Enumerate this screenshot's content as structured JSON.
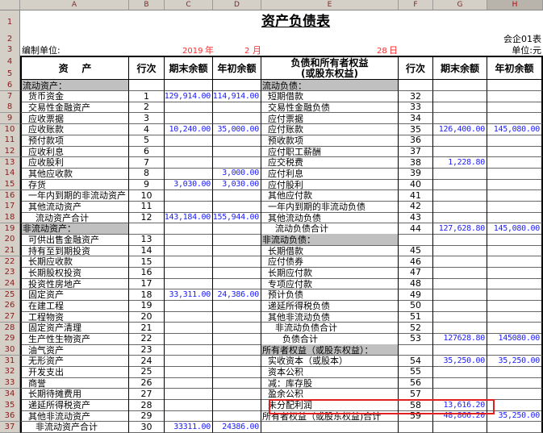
{
  "columns": [
    "A",
    "B",
    "C",
    "D",
    "E",
    "F",
    "G",
    "H"
  ],
  "selected_column": "H",
  "title": "资产负债表",
  "form_code": "会企01表",
  "compiler_label": "编制单位:",
  "date": {
    "year": "2019",
    "year_unit": "年",
    "month": "2",
    "month_unit": "月",
    "day": "28",
    "day_unit": "日"
  },
  "unit": "单位:元",
  "headers": {
    "assets": "资    产",
    "line": "行次",
    "end_balance": "期末余额",
    "begin_balance": "年初余额",
    "liabilities": "负债和所有者权益",
    "liabilities_sub": "(或股东权益)"
  },
  "highlight_color": "#e02020",
  "highlighted_item": "未分配利润",
  "rows": [
    {
      "r": 6,
      "left": {
        "label": "流动资产：",
        "section": true
      },
      "right": {
        "label": "流动负债：",
        "section": true
      }
    },
    {
      "r": 7,
      "left": {
        "label": "货币资金",
        "line": "1",
        "end": "129,914.00",
        "begin": "114,914.00"
      },
      "right": {
        "label": "短期借款",
        "line": "32"
      }
    },
    {
      "r": 8,
      "left": {
        "label": "交易性金融资产",
        "line": "2"
      },
      "right": {
        "label": "交易性金融负债",
        "line": "33"
      }
    },
    {
      "r": 9,
      "left": {
        "label": "应收票据",
        "line": "3"
      },
      "right": {
        "label": "应付票据",
        "line": "34"
      }
    },
    {
      "r": 10,
      "left": {
        "label": "应收账款",
        "line": "4",
        "end": "10,240.00",
        "begin": "35,000.00"
      },
      "right": {
        "label": "应付账款",
        "line": "35",
        "end": "126,400.00",
        "begin": "145,080.00"
      }
    },
    {
      "r": 11,
      "left": {
        "label": "预付款项",
        "line": "5"
      },
      "right": {
        "label": "预收款项",
        "line": "36"
      }
    },
    {
      "r": 12,
      "left": {
        "label": "应收利息",
        "line": "6"
      },
      "right": {
        "label": "应付职工薪酬",
        "line": "37"
      }
    },
    {
      "r": 13,
      "left": {
        "label": "应收股利",
        "line": "7"
      },
      "right": {
        "label": "应交税费",
        "line": "38",
        "end": "1,228.80"
      }
    },
    {
      "r": 14,
      "left": {
        "label": "其他应收款",
        "line": "8",
        "begin": "3,000.00"
      },
      "right": {
        "label": "应付利息",
        "line": "39"
      }
    },
    {
      "r": 15,
      "left": {
        "label": "存货",
        "line": "9",
        "end": "3,030.00",
        "begin": "3,030.00"
      },
      "right": {
        "label": "应付股利",
        "line": "40"
      }
    },
    {
      "r": 16,
      "left": {
        "label": "一年内到期的非流动资产",
        "line": "10"
      },
      "right": {
        "label": "其他应付款",
        "line": "41"
      }
    },
    {
      "r": 17,
      "left": {
        "label": "其他流动资产",
        "line": "11"
      },
      "right": {
        "label": "一年内到期的非流动负债",
        "line": "42"
      }
    },
    {
      "r": 18,
      "left": {
        "label": "流动资产合计",
        "line": "12",
        "end": "143,184.00",
        "begin": "155,944.00",
        "indent": 2
      },
      "right": {
        "label": "其他流动负债",
        "line": "43"
      }
    },
    {
      "r": 19,
      "left": {
        "label": "非流动资产：",
        "section": true
      },
      "right": {
        "label": "流动负债合计",
        "line": "44",
        "end": "127,628.80",
        "begin": "145,080.00",
        "indent": 2
      }
    },
    {
      "r": 20,
      "left": {
        "label": "可供出售金融资产",
        "line": "13"
      },
      "right": {
        "label": "非流动负债：",
        "section": true
      }
    },
    {
      "r": 21,
      "left": {
        "label": "持有至到期投资",
        "line": "14"
      },
      "right": {
        "label": "长期借款",
        "line": "45"
      }
    },
    {
      "r": 22,
      "left": {
        "label": "长期应收款",
        "line": "15"
      },
      "right": {
        "label": "应付债券",
        "line": "46"
      }
    },
    {
      "r": 23,
      "left": {
        "label": "长期股权投资",
        "line": "16"
      },
      "right": {
        "label": "长期应付款",
        "line": "47"
      }
    },
    {
      "r": 24,
      "left": {
        "label": "投资性房地产",
        "line": "17"
      },
      "right": {
        "label": "专项应付款",
        "line": "48"
      }
    },
    {
      "r": 25,
      "left": {
        "label": "固定资产",
        "line": "18",
        "end": "33,311.00",
        "begin": "24,386.00"
      },
      "right": {
        "label": "预计负债",
        "line": "49"
      }
    },
    {
      "r": 26,
      "left": {
        "label": "在建工程",
        "line": "19"
      },
      "right": {
        "label": "递延所得税负债",
        "line": "50"
      }
    },
    {
      "r": 27,
      "left": {
        "label": "工程物资",
        "line": "20"
      },
      "right": {
        "label": "其他非流动负债",
        "line": "51"
      }
    },
    {
      "r": 28,
      "left": {
        "label": "固定资产清理",
        "line": "21"
      },
      "right": {
        "label": "非流动负债合计",
        "line": "52",
        "indent": 2
      }
    },
    {
      "r": 29,
      "left": {
        "label": "生产性生物资产",
        "line": "22"
      },
      "right": {
        "label": "负债合计",
        "line": "53",
        "end": "127628.80",
        "begin": "145080.00",
        "indent": 3
      }
    },
    {
      "r": 30,
      "left": {
        "label": "油气资产",
        "line": "23"
      },
      "right": {
        "label": "所有者权益（或股东权益）：",
        "section": true
      }
    },
    {
      "r": 31,
      "left": {
        "label": "无形资产",
        "line": "24"
      },
      "right": {
        "label": "实收资本（或股本）",
        "line": "54",
        "end": "35,250.00",
        "begin": "35,250.00"
      }
    },
    {
      "r": 32,
      "left": {
        "label": "开发支出",
        "line": "25"
      },
      "right": {
        "label": "资本公积",
        "line": "55"
      }
    },
    {
      "r": 33,
      "left": {
        "label": "商誉",
        "line": "26"
      },
      "right": {
        "label": "减：库存股",
        "line": "56"
      }
    },
    {
      "r": 34,
      "left": {
        "label": "长期待摊费用",
        "line": "27"
      },
      "right": {
        "label": "盈余公积",
        "line": "57"
      }
    },
    {
      "r": 35,
      "left": {
        "label": "递延所得税资产",
        "line": "28"
      },
      "right": {
        "label": "未分配利润",
        "line": "58",
        "end": "13,616.20"
      }
    },
    {
      "r": 36,
      "left": {
        "label": "其他非流动资产",
        "line": "29"
      },
      "right": {
        "label": "所有者权益（或股东权益)合计",
        "line": "59",
        "end": "48,866.20",
        "begin": "35,250.00",
        "indent": 0
      }
    },
    {
      "r": 37,
      "left": {
        "label": "非流动资产合计",
        "line": "30",
        "end": "33311.00",
        "begin": "24386.00",
        "indent": 2
      },
      "right": {
        "label": ""
      }
    }
  ]
}
